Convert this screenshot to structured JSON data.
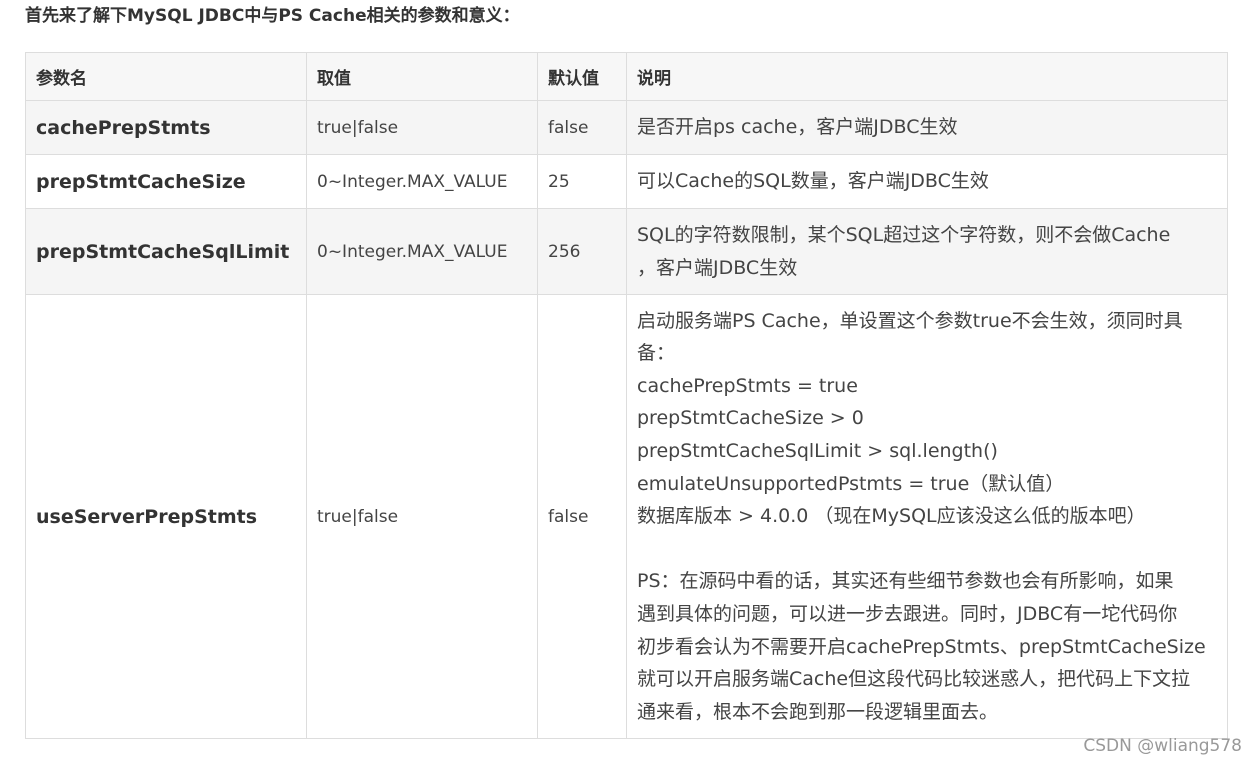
{
  "intro": "首先来了解下MySQL JDBC中与PS Cache相关的参数和意义：",
  "table": {
    "headers": {
      "name": "参数名",
      "value": "取值",
      "default": "默认值",
      "desc": "说明"
    },
    "rows": [
      {
        "name": "cachePrepStmts",
        "value": "true|false",
        "default": "false",
        "desc": [
          "是否开启ps cache，客户端JDBC生效"
        ]
      },
      {
        "name": "prepStmtCacheSize",
        "value": "0~Integer.MAX_VALUE",
        "default": "25",
        "desc": [
          "可以Cache的SQL数量，客户端JDBC生效"
        ]
      },
      {
        "name": "prepStmtCacheSqlLimit",
        "value": "0~Integer.MAX_VALUE",
        "default": "256",
        "desc": [
          "SQL的字符数限制，某个SQL超过这个字符数，则不会做Cache",
          "，客户端JDBC生效"
        ]
      },
      {
        "name": "useServerPrepStmts",
        "value": "true|false",
        "default": "false",
        "desc": [
          "启动服务端PS Cache，单设置这个参数true不会生效，须同时具",
          "备：",
          "cachePrepStmts = true",
          "prepStmtCacheSize > 0",
          "prepStmtCacheSqlLimit > sql.length()",
          "emulateUnsupportedPstmts = true（默认值）",
          "数据库版本 > 4.0.0 （现在MySQL应该没这么低的版本吧）",
          "",
          "PS：在源码中看的话，其实还有些细节参数也会有所影响，如果",
          "遇到具体的问题，可以进一步去跟进。同时，JDBC有一坨代码你",
          "初步看会认为不需要开启cachePrepStmts、prepStmtCacheSize",
          "就可以开启服务端Cache但这段代码比较迷惑人，把代码上下文拉",
          "通来看，根本不会跑到那一段逻辑里面去。"
        ]
      }
    ]
  },
  "watermark": "CSDN @wliang578"
}
